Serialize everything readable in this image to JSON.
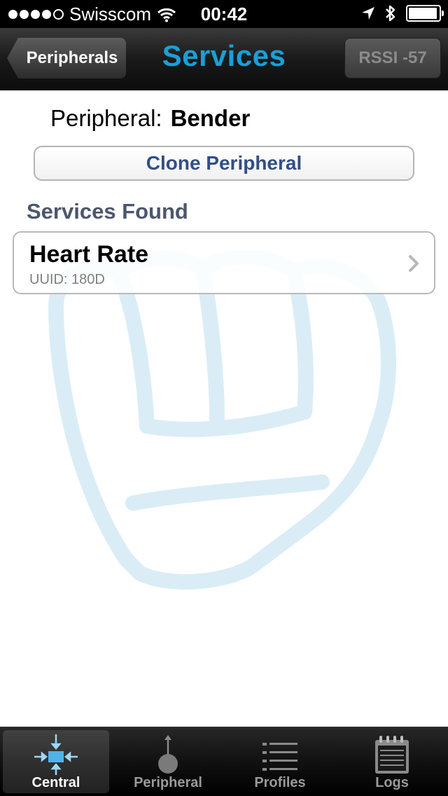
{
  "status_bar": {
    "carrier": "Swisscom",
    "time": "00:42",
    "signal_dots_filled": 4,
    "signal_dots_total": 5,
    "icons": [
      "wifi-icon",
      "location-arrow-icon",
      "bluetooth-icon",
      "battery-icon"
    ]
  },
  "nav": {
    "back_label": "Peripherals",
    "title": "Services",
    "rssi_label": "RSSI -57"
  },
  "peripheral": {
    "label": "Peripheral:",
    "name": "Bender"
  },
  "clone_button_label": "Clone Peripheral",
  "services_header": "Services Found",
  "services": [
    {
      "name": "Heart Rate",
      "uuid": "UUID: 180D"
    }
  ],
  "tabs": [
    {
      "label": "Central",
      "icon": "central-icon",
      "active": true
    },
    {
      "label": "Peripheral",
      "icon": "peripheral-icon",
      "active": false
    },
    {
      "label": "Profiles",
      "icon": "profiles-list-icon",
      "active": false
    },
    {
      "label": "Logs",
      "icon": "notepad-icon",
      "active": false
    }
  ],
  "colors": {
    "nav_title": "#1a9fd6",
    "clone_text": "#324f85",
    "section_header": "#4c566c",
    "watermark": "#d6ecf6"
  }
}
